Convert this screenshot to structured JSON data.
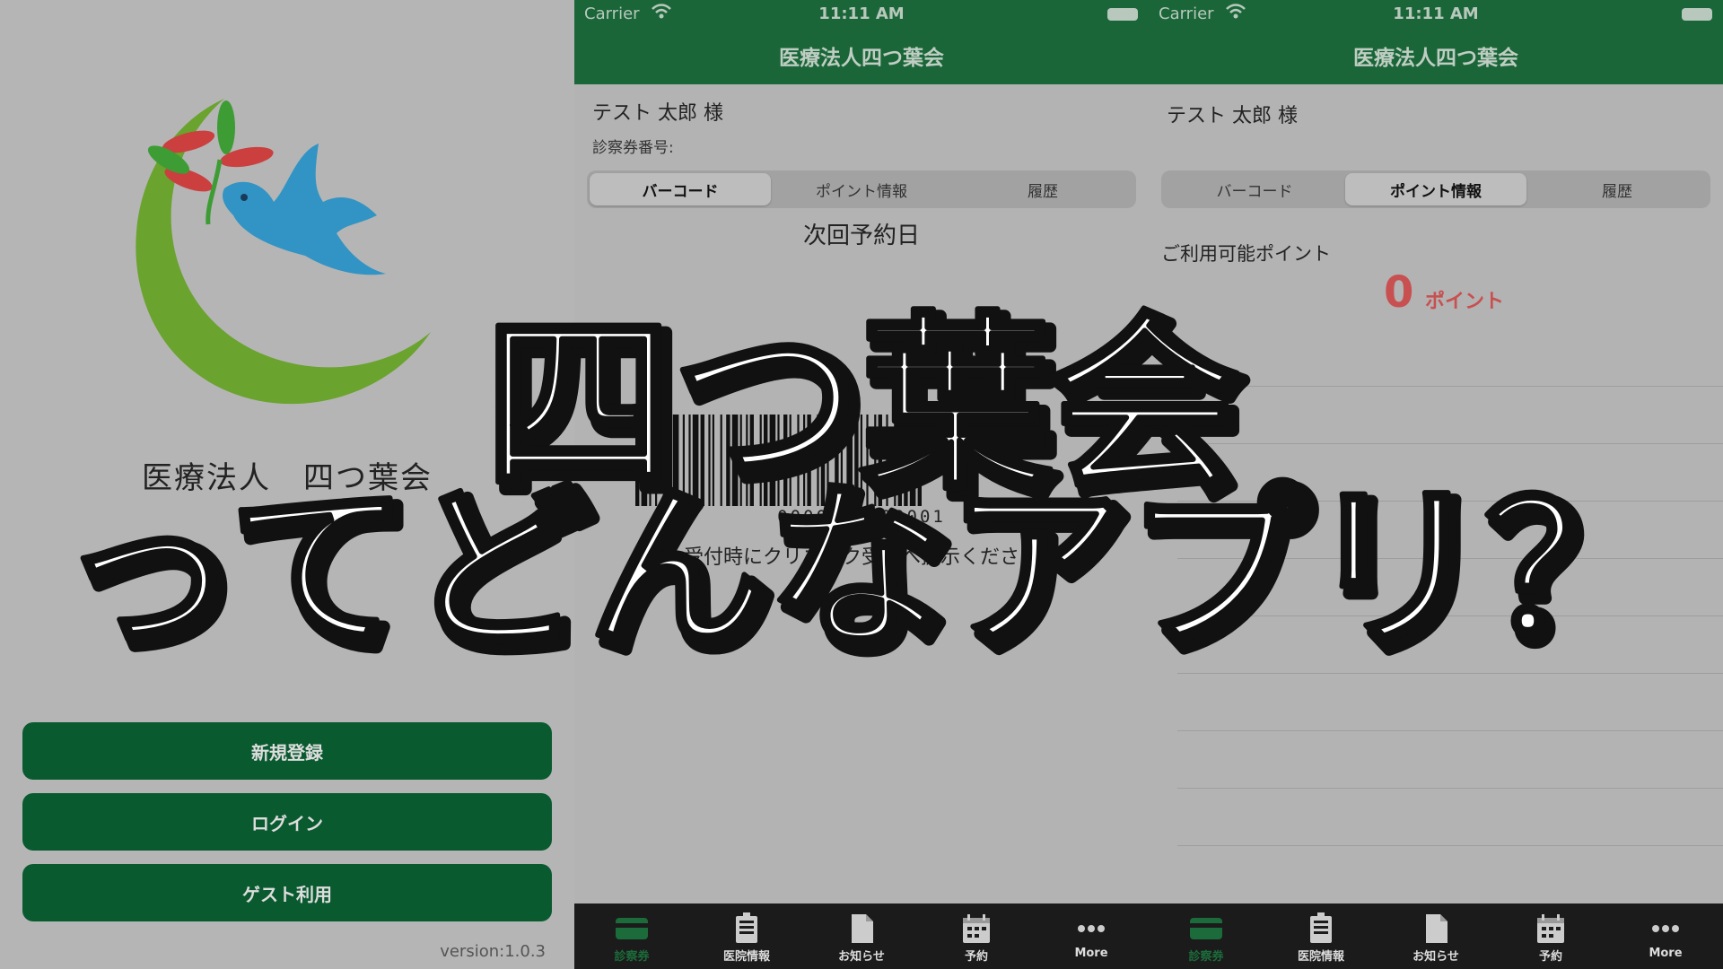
{
  "login": {
    "org_name": "医療法人　四つ葉会",
    "buttons": {
      "register": "新規登録",
      "login": "ログイン",
      "guest": "ゲスト利用"
    },
    "version": "version:1.0.3"
  },
  "status_bar": {
    "carrier": "Carrier",
    "time": "11:11 AM"
  },
  "header": {
    "title": "医療法人四つ葉会"
  },
  "user": {
    "name": "テスト 太郎 様",
    "card_number_label": "診察券番号:"
  },
  "tabs": {
    "barcode": "バーコード",
    "points": "ポイント情報",
    "history": "履歴"
  },
  "barcode_screen": {
    "next_appointment_label": "次回予約日",
    "barcode_number": "0000000000001",
    "present_text": "受付時にクリニック受付へ提示ください"
  },
  "points_screen": {
    "available_label": "ご利用可能ポイント",
    "points_value": "0",
    "points_unit": "ポイント"
  },
  "tab_bar": [
    {
      "label": "診察券",
      "icon": "card-icon",
      "active": true
    },
    {
      "label": "医院情報",
      "icon": "building-icon",
      "active": false
    },
    {
      "label": "お知らせ",
      "icon": "document-icon",
      "active": false
    },
    {
      "label": "予約",
      "icon": "calendar-icon",
      "active": false
    },
    {
      "label": "More",
      "icon": "more-icon",
      "active": false
    }
  ],
  "overlay": {
    "line1": "四つ葉会",
    "line2": "ってどんなアプリ？"
  },
  "colors": {
    "brand_green": "#1a6638",
    "button_green": "#0a5a30",
    "points_red": "#c85050",
    "tab_active": "#1c6b3a"
  }
}
